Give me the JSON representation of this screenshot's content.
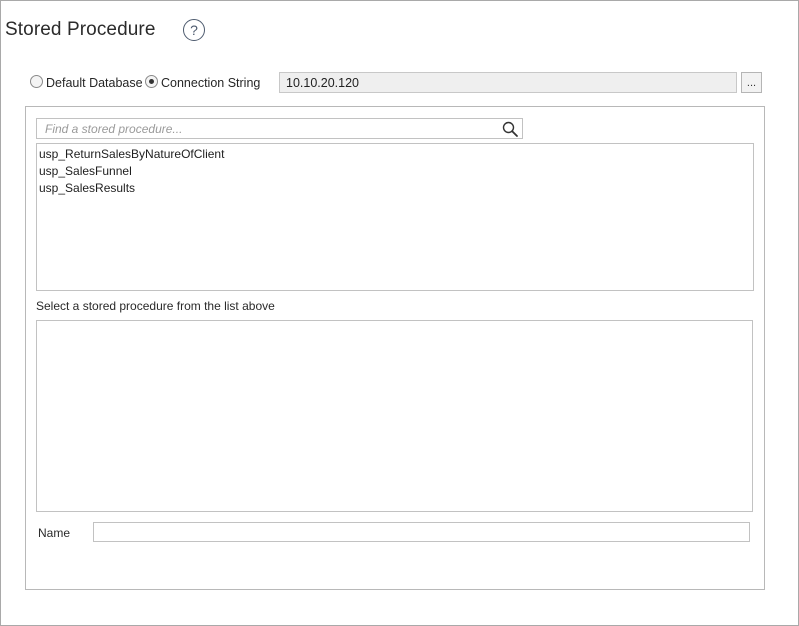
{
  "header": {
    "title": "Stored Procedure",
    "help_glyph": "?"
  },
  "source": {
    "options": [
      {
        "label": "Default Database",
        "selected": false
      },
      {
        "label": "Connection String",
        "selected": true
      }
    ],
    "connection_value": "10.10.20.120",
    "browse_label": "..."
  },
  "search": {
    "placeholder": "Find a stored procedure...",
    "icon": "search-icon"
  },
  "procedures": [
    "usp_ReturnSalesByNatureOfClient",
    "usp_SalesFunnel",
    "usp_SalesResults"
  ],
  "details": {
    "hint": "Select a stored procedure from the list above"
  },
  "name_field": {
    "label": "Name",
    "value": ""
  },
  "colors": {
    "border": "#c2c2c2",
    "disabled_field": "#efefef",
    "help_icon": "#4d5a6e"
  }
}
